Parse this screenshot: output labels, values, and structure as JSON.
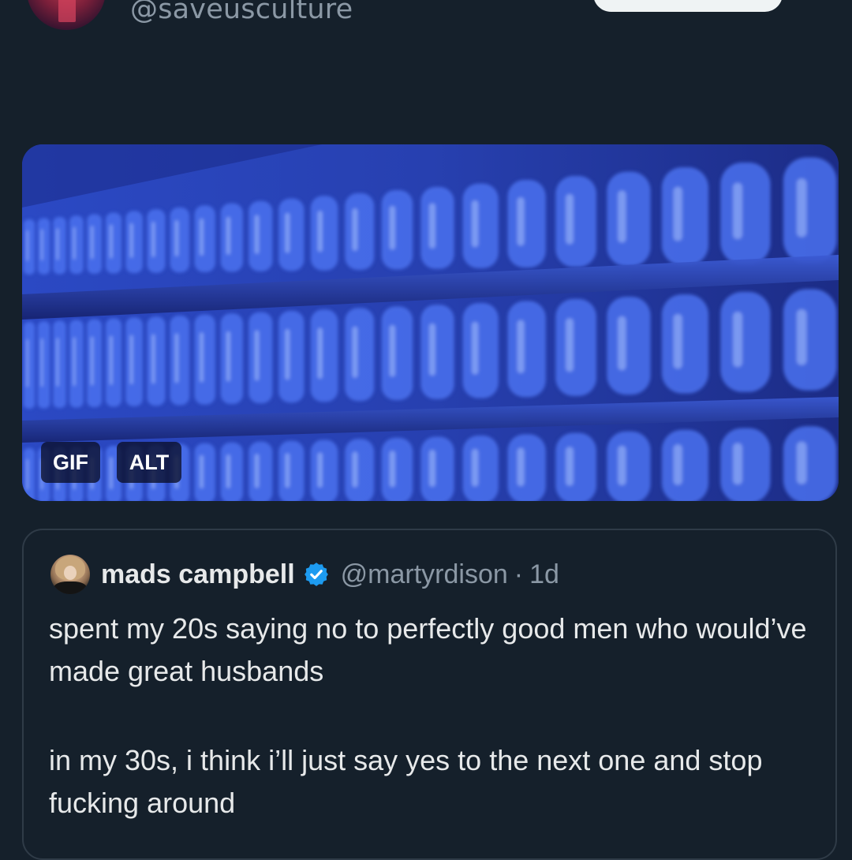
{
  "post": {
    "handle": "@saveusculture"
  },
  "media": {
    "gif_badge": "GIF",
    "alt_badge": "ALT"
  },
  "quoted_tweet": {
    "author_name": "mads campbell",
    "author_handle": "@martyrdison",
    "separator": "·",
    "time": "1d",
    "paragraph_1": "spent my 20s saying no to perfectly good men who would’ve made great husbands",
    "paragraph_2": "in my 30s, i think i’ll just say yes to the next one and stop fucking around",
    "verified_icon": "verified-badge-icon"
  },
  "colors": {
    "background": "#15202b",
    "text_primary": "#e7e9ea",
    "text_secondary": "#8b98a5",
    "verified_blue": "#1d9bf0",
    "card_border": "#2f3b47"
  }
}
